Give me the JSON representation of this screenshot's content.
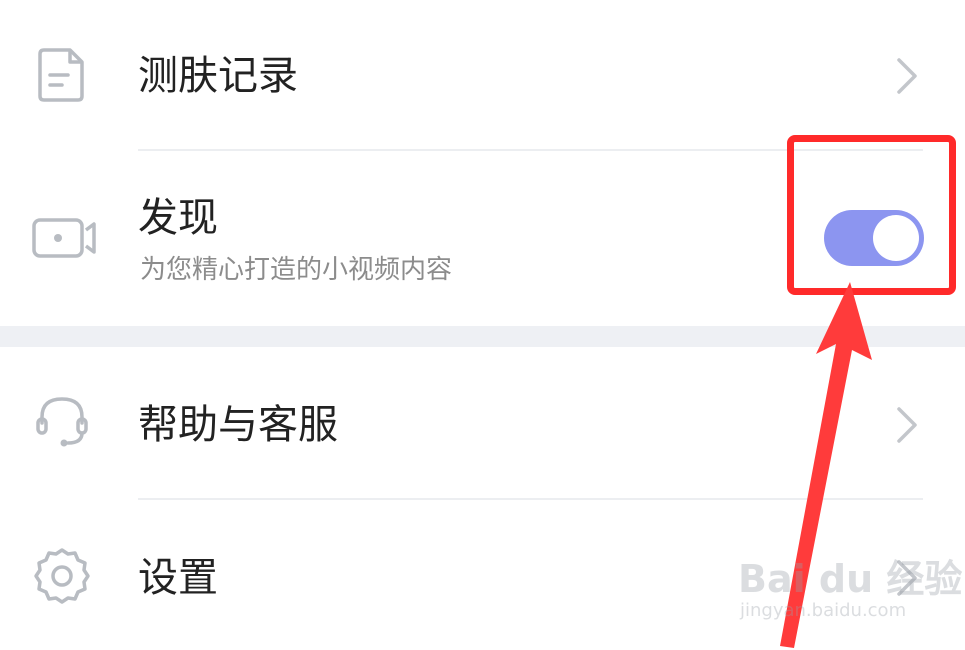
{
  "menu": {
    "items": [
      {
        "title": "测肤记录",
        "icon": "document-icon",
        "action": "chevron-right-icon"
      },
      {
        "title": "发现",
        "subtitle": "为您精心打造的小视频内容",
        "icon": "video-camera-icon",
        "toggle_on": true
      },
      {
        "title": "帮助与客服",
        "icon": "headset-icon",
        "action": "chevron-right-icon"
      },
      {
        "title": "设置",
        "icon": "gear-icon",
        "action": "chevron-right-icon"
      }
    ]
  },
  "colors": {
    "toggle_on": "#8c95f0",
    "annotation": "#ff2a2a",
    "title_text": "#222222",
    "subtitle_text": "#8c8c8c",
    "separator_band": "#eef0f4"
  },
  "watermark": {
    "main": "Bai du 经验",
    "sub": "jingyan.baidu.com"
  }
}
